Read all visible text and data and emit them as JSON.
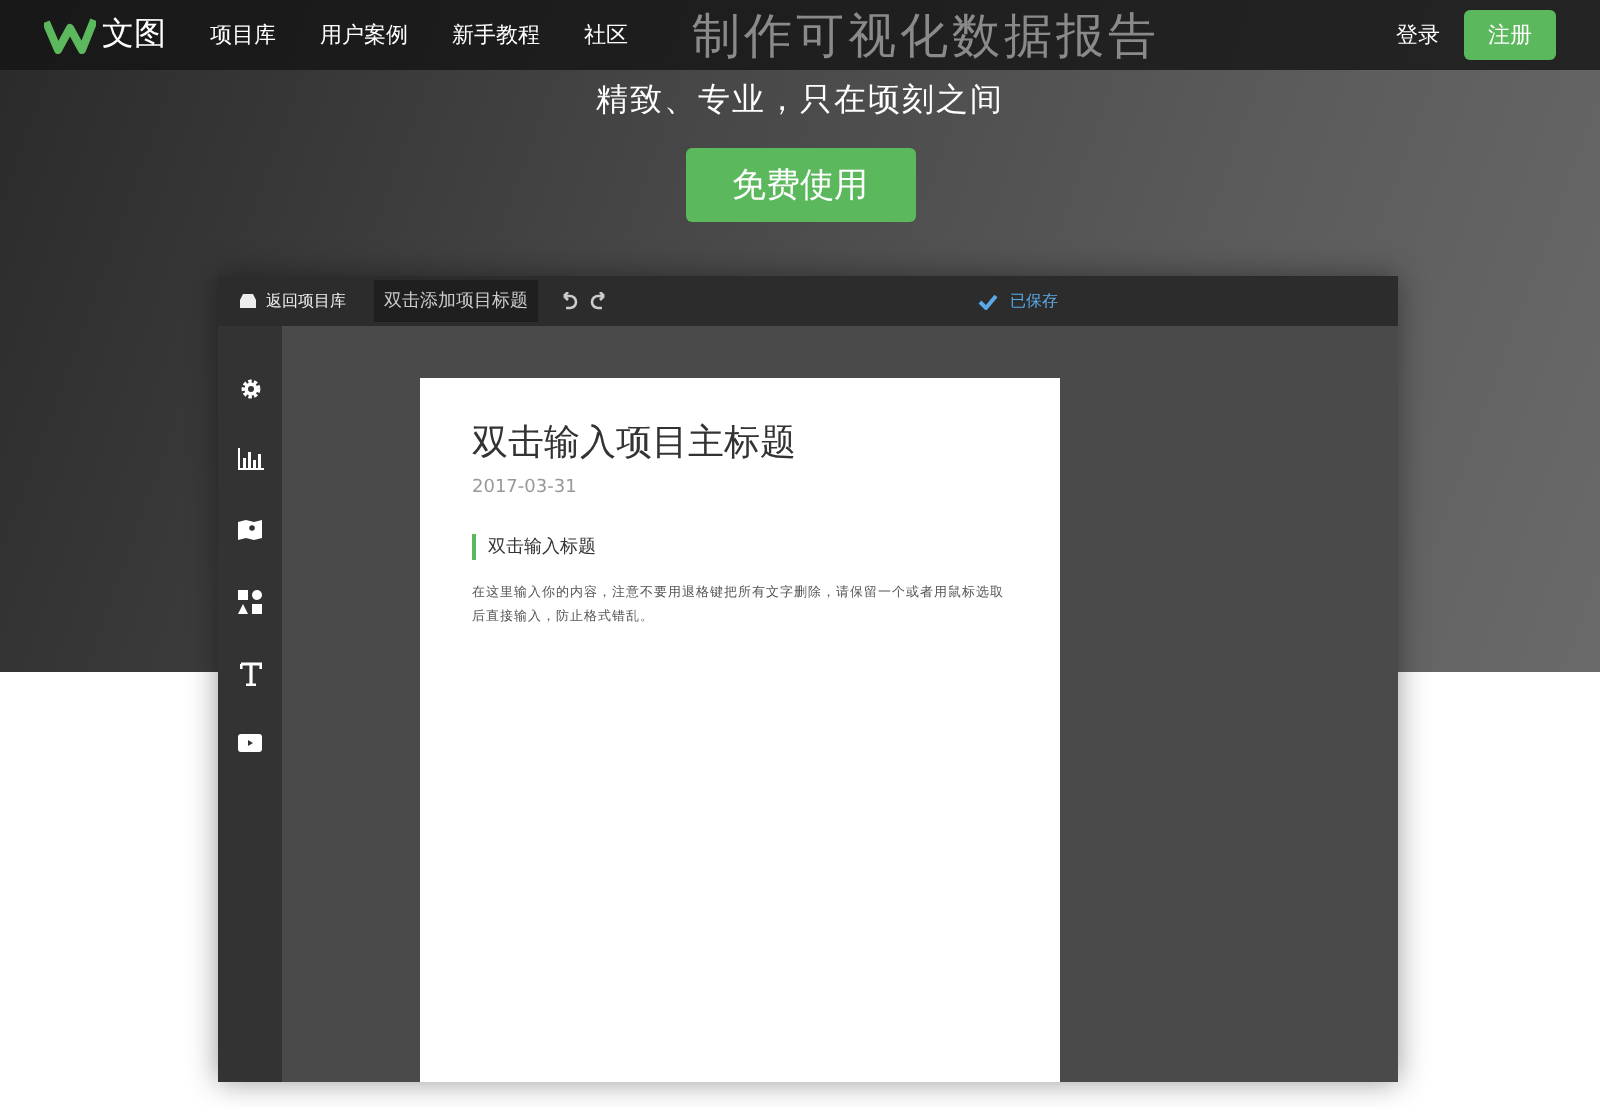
{
  "nav": {
    "logo_text": "文图",
    "links": [
      "项目库",
      "用户案例",
      "新手教程",
      "社区"
    ],
    "login": "登录",
    "register": "注册"
  },
  "hero": {
    "title": "制作可视化数据报告",
    "subtitle": "精致、专业，只在顷刻之间",
    "cta": "免费使用"
  },
  "editor": {
    "back": "返回项目库",
    "title_field": "双击添加项目标题",
    "saved": "已保存",
    "tools": [
      {
        "kind": "settings"
      },
      {
        "kind": "chart"
      },
      {
        "kind": "map"
      },
      {
        "kind": "shapes"
      },
      {
        "kind": "text"
      },
      {
        "kind": "media"
      }
    ],
    "doc": {
      "title": "双击输入项目主标题",
      "date": "2017-03-31",
      "heading": "双击输入标题",
      "body": "在这里输入你的内容，注意不要用退格键把所有文字删除，请保留一个或者用鼠标选取后直接输入，防止格式错乱。"
    }
  }
}
